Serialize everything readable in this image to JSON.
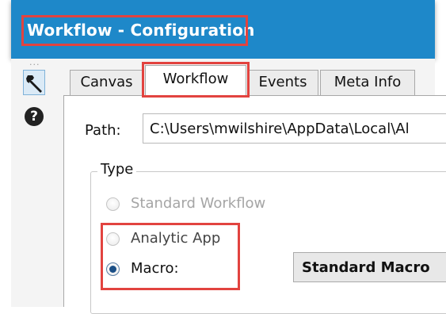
{
  "window": {
    "title": "Workflow - Configuration"
  },
  "toolbar": {
    "handle": "...",
    "help_glyph": "?"
  },
  "tabs": [
    {
      "label": "Canvas",
      "active": false
    },
    {
      "label": "Workflow",
      "active": true
    },
    {
      "label": "Events",
      "active": false
    },
    {
      "label": "Meta Info",
      "active": false
    }
  ],
  "path": {
    "label": "Path:",
    "value": "C:\\Users\\mwilshire\\AppData\\Local\\Al"
  },
  "type_group": {
    "title": "Type",
    "options": [
      {
        "label": "Standard Workflow",
        "checked": false,
        "enabled": false
      },
      {
        "label": "Analytic App",
        "checked": false,
        "enabled": false
      },
      {
        "label": "Macro:",
        "checked": true,
        "enabled": true
      }
    ],
    "macro_type": "Standard Macro"
  },
  "colors": {
    "titlebar": "#1e88c9",
    "highlight": "#e2433f"
  }
}
